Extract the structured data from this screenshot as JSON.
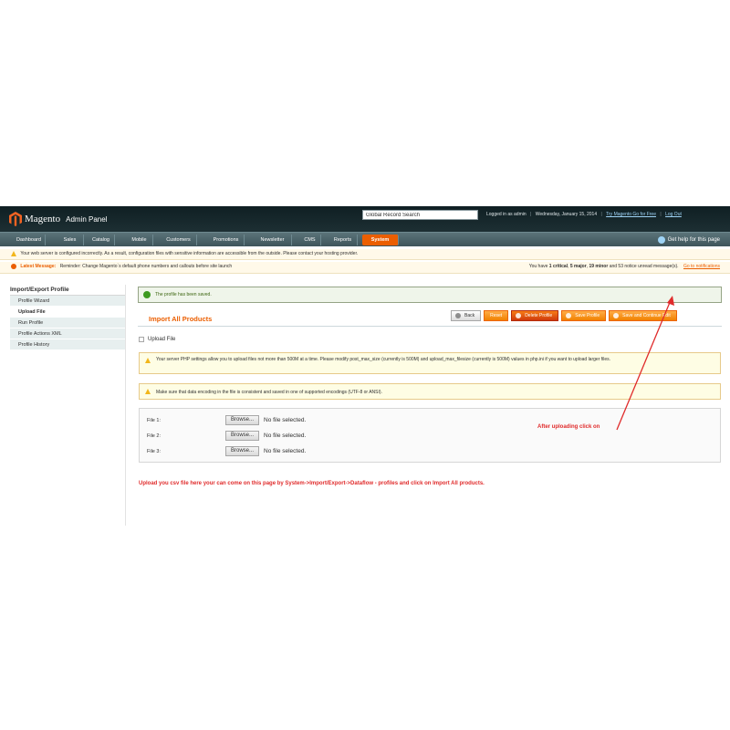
{
  "header": {
    "logo_text": "Magento",
    "logo_sub": "Admin Panel",
    "search_value": "Global Record Search",
    "logged_in": "Logged in as admin",
    "date": "Wednesday, January 15, 2014",
    "try_link": "Try Magento Go for Free",
    "logout": "Log Out"
  },
  "nav": {
    "items": [
      "Dashboard",
      "Sales",
      "Catalog",
      "Mobile",
      "Customers",
      "Promotions",
      "Newsletter",
      "CMS",
      "Reports",
      "System"
    ],
    "active": "System",
    "help": "Get help for this page"
  },
  "messages": {
    "config_warning": "Your web server is configured incorrectly. As a result, configuration files with sensitive information are accessible from the outside. Please contact your hosting provider.",
    "latest_label": "Latest Message:",
    "latest_text": "Reminder: Change Magento`s default phone numbers and callouts before site launch",
    "count_prefix": "You have",
    "critical": "1 critical",
    "major": "5 major",
    "minor": "19 minor",
    "notice": "and 53 notice unread message(s).",
    "go_link": "Go to notifications"
  },
  "sidebar": {
    "title": "Import/Export Profile",
    "items": [
      "Profile Wizard",
      "Upload File",
      "Run Profile",
      "Profile Actions XML",
      "Profile History"
    ],
    "active": "Upload File"
  },
  "content": {
    "success": "The profile has been saved.",
    "title": "Import All Products",
    "buttons": {
      "back": "Back",
      "reset": "Reset",
      "delete": "Delete Profile",
      "save": "Save Profile",
      "save_continue": "Save and Continue Edit"
    },
    "section": "Upload File",
    "notice1": "Your server PHP settings allow you to upload files not more than 500M at a time. Please modify post_max_size (currently is 500M) and upload_max_filesize (currently is 500M) values in php.ini if you want to upload larger files.",
    "notice2": "Make sure that data encoding in the file is consistent and saved in one of supported encodings (UTF-8 or ANSI).",
    "files": [
      {
        "label": "File 1:",
        "browse": "Browse...",
        "status": "No file selected."
      },
      {
        "label": "File 2:",
        "browse": "Browse...",
        "status": "No file selected."
      },
      {
        "label": "File 3:",
        "browse": "Browse...",
        "status": "No file selected."
      }
    ]
  },
  "annotations": {
    "after_upload": "After uploading click on",
    "instructions": "Upload you csv file here your can come on this page by System->Import/Export->Dataflow - profiles and click on Import All products."
  },
  "colors": {
    "accent": "#eb5e00",
    "annotation": "#e02b2b",
    "header_bg": "#1d2f33",
    "nav_bg": "#4a6268"
  }
}
